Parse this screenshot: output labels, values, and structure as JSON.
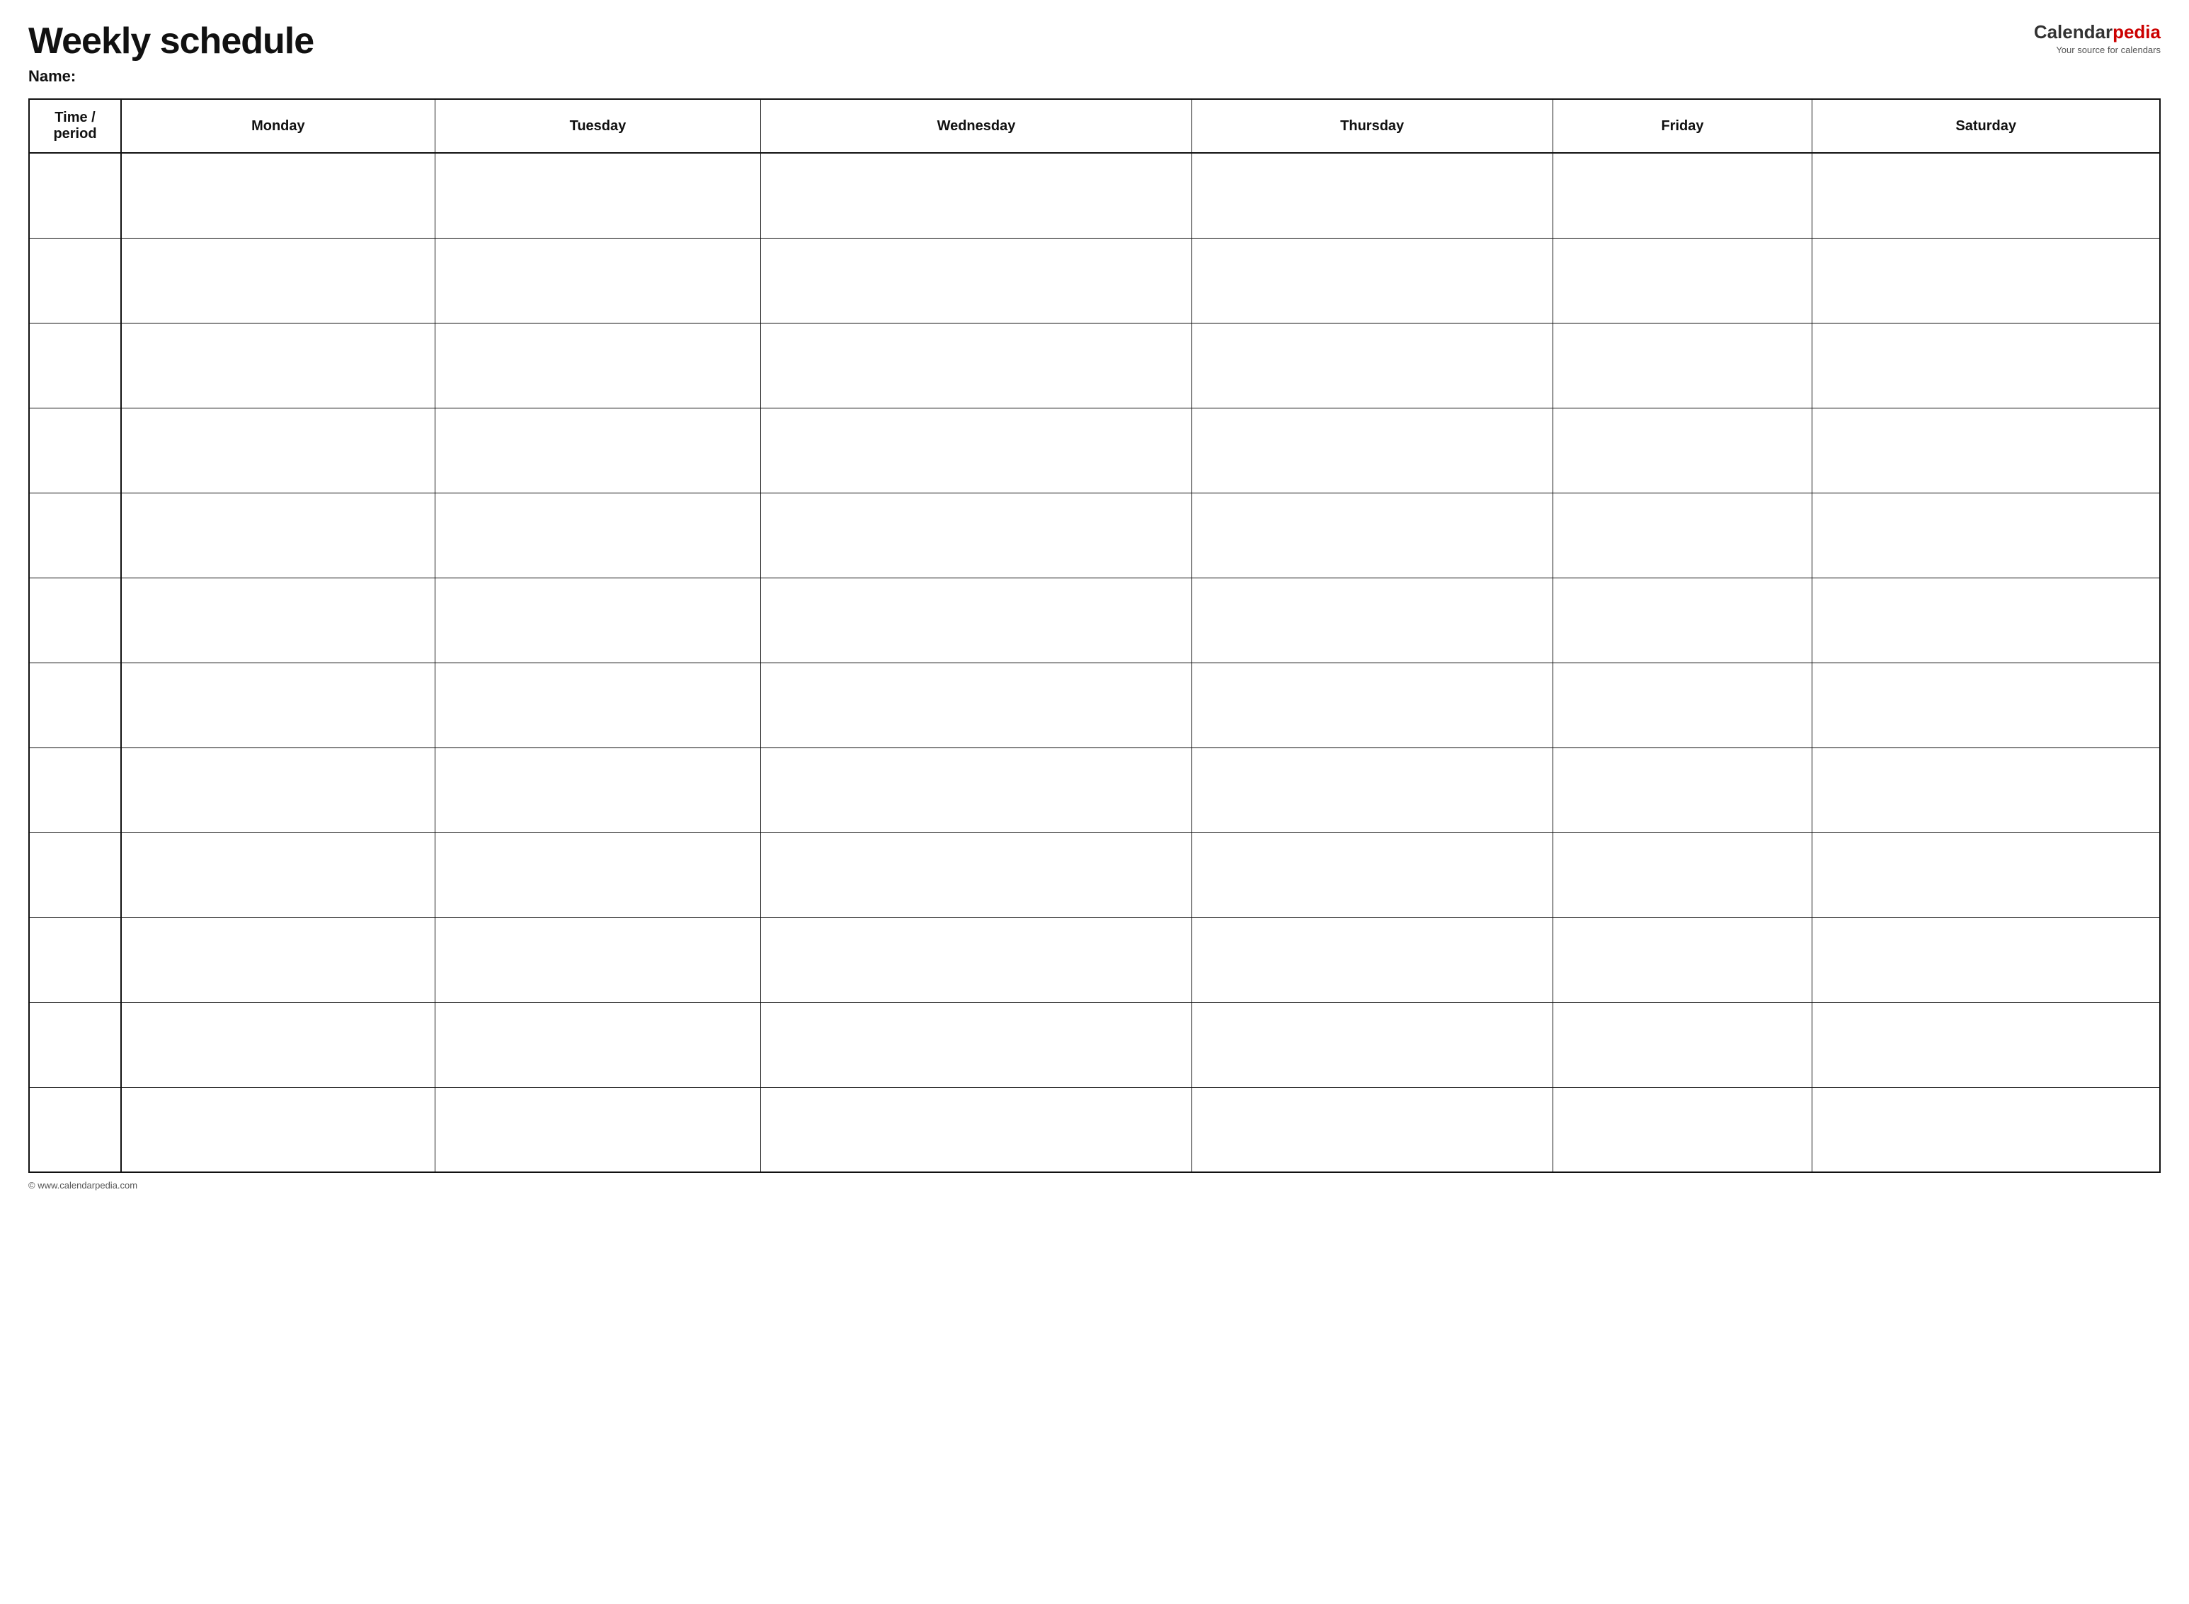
{
  "header": {
    "title": "Weekly schedule",
    "name_label": "Name:",
    "logo": {
      "text_black": "Calendar",
      "text_red": "pedia",
      "subtext": "Your source for calendars"
    }
  },
  "table": {
    "columns": [
      "Time / period",
      "Monday",
      "Tuesday",
      "Wednesday",
      "Thursday",
      "Friday",
      "Saturday"
    ],
    "row_count": 12
  },
  "footer": {
    "text": "© www.calendarpedia.com"
  }
}
